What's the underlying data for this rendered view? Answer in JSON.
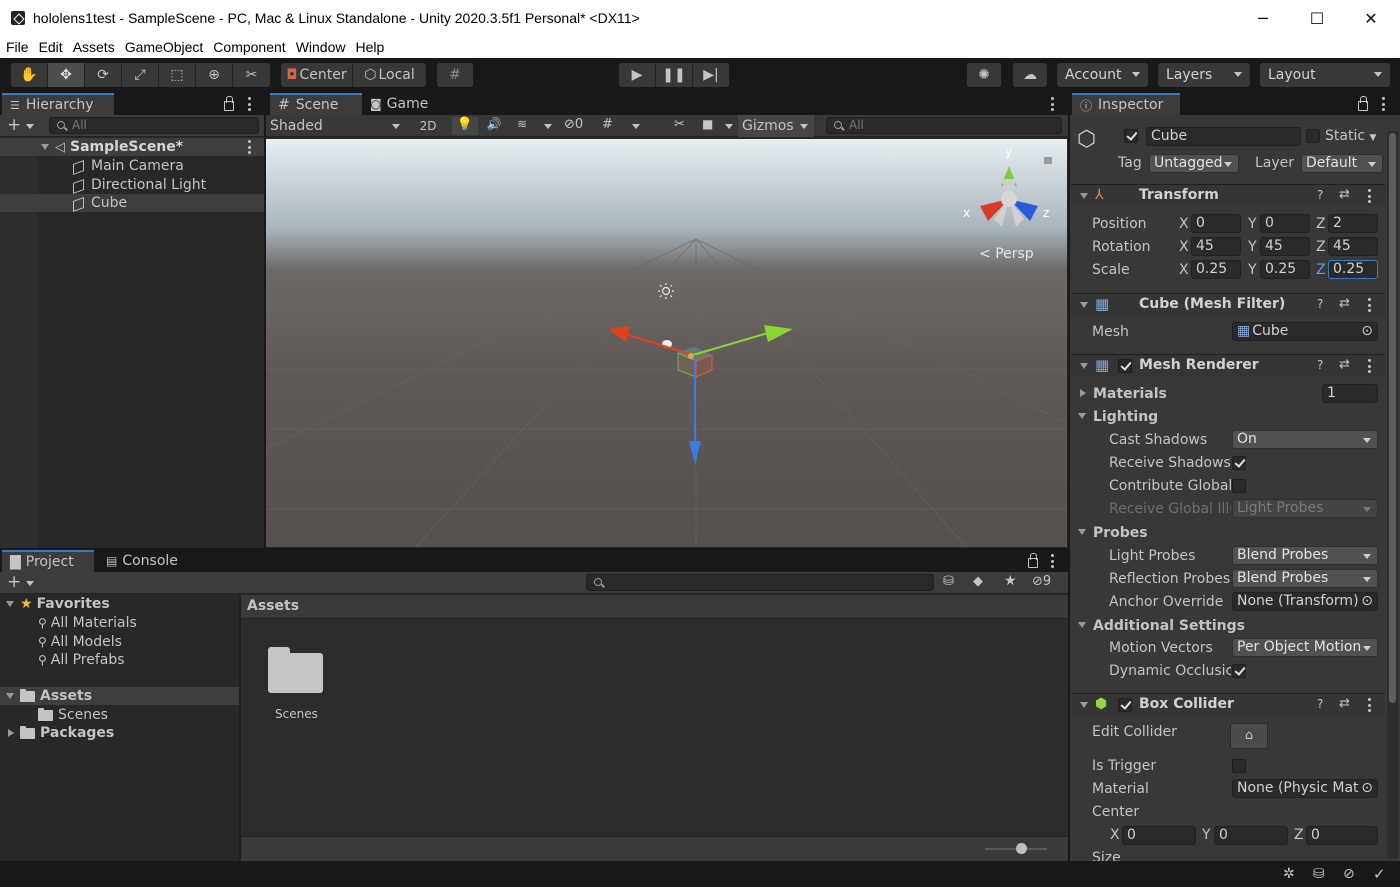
{
  "window": {
    "title": "hololens1test - SampleScene - PC, Mac & Linux Standalone - Unity 2020.3.5f1 Personal* <DX11>",
    "minimize": "─",
    "maximize": "☐",
    "close": "✕"
  },
  "menu": [
    "File",
    "Edit",
    "Assets",
    "GameObject",
    "Component",
    "Window",
    "Help"
  ],
  "toolbar": {
    "pivot_label": "Center",
    "space_label": "Local",
    "account_label": "Account",
    "layers_label": "Layers",
    "layout_label": "Layout"
  },
  "hierarchy": {
    "tab": "Hierarchy",
    "search_placeholder": "All",
    "scene": "SampleScene*",
    "items": [
      "Main Camera",
      "Directional Light",
      "Cube"
    ]
  },
  "scene": {
    "tab_scene": "Scene",
    "tab_game": "Game",
    "shading": "Shaded",
    "mode_2d": "2D",
    "hidden_count": "0",
    "gizmos": "Gizmos",
    "search_placeholder": "All",
    "persp_label": "Persp",
    "axis_x": "x",
    "axis_y": "y",
    "axis_z": "z"
  },
  "project": {
    "tab_project": "Project",
    "tab_console": "Console",
    "favorites": "Favorites",
    "fav_items": [
      "All Materials",
      "All Models",
      "All Prefabs"
    ],
    "assets": "Assets",
    "scenes": "Scenes",
    "packages": "Packages",
    "breadcrumb": "Assets",
    "grid_item": "Scenes",
    "hidden_packages": "9"
  },
  "inspector": {
    "tab": "Inspector",
    "object_name": "Cube",
    "static_label": "Static",
    "tag_label": "Tag",
    "tag_value": "Untagged",
    "layer_label": "Layer",
    "layer_value": "Default",
    "transform": {
      "title": "Transform",
      "position_label": "Position",
      "rotation_label": "Rotation",
      "scale_label": "Scale",
      "position": {
        "x": "0",
        "y": "0",
        "z": "2"
      },
      "rotation": {
        "x": "45",
        "y": "45",
        "z": "45"
      },
      "scale": {
        "x": "0.25",
        "y": "0.25",
        "z": "0.25"
      }
    },
    "mesh_filter": {
      "title": "Cube (Mesh Filter)",
      "mesh_label": "Mesh",
      "mesh_value": "Cube"
    },
    "mesh_renderer": {
      "title": "Mesh Renderer",
      "materials_label": "Materials",
      "materials_count": "1",
      "lighting_label": "Lighting",
      "cast_shadows_label": "Cast Shadows",
      "cast_shadows_value": "On",
      "receive_shadows_label": "Receive Shadows",
      "contribute_gi_label": "Contribute Global",
      "receive_gi_label": "Receive Global Illu",
      "receive_gi_value": "Light Probes",
      "probes_label": "Probes",
      "light_probes_label": "Light Probes",
      "light_probes_value": "Blend Probes",
      "reflection_probes_label": "Reflection Probes",
      "reflection_probes_value": "Blend Probes",
      "anchor_override_label": "Anchor Override",
      "anchor_override_value": "None (Transform)",
      "additional_label": "Additional Settings",
      "motion_vectors_label": "Motion Vectors",
      "motion_vectors_value": "Per Object Motion",
      "dynamic_occlusion_label": "Dynamic Occlusic"
    },
    "box_collider": {
      "title": "Box Collider",
      "edit_collider_label": "Edit Collider",
      "is_trigger_label": "Is Trigger",
      "material_label": "Material",
      "material_value": "None (Physic Mat",
      "center_label": "Center",
      "center": {
        "x": "0",
        "y": "0",
        "z": "0"
      },
      "size_label": "Size"
    },
    "axis_labels": {
      "x": "X",
      "y": "Y",
      "z": "Z"
    }
  }
}
